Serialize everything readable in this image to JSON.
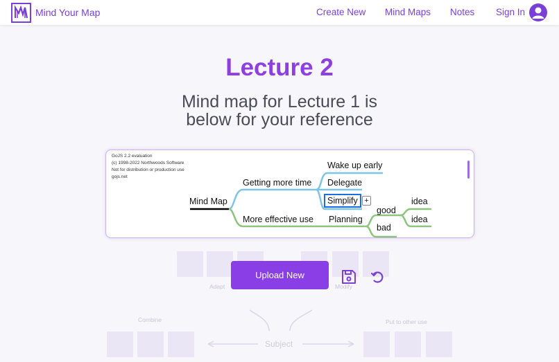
{
  "header": {
    "brand": "Mind Your Map",
    "nav": [
      "Create New",
      "Mind Maps",
      "Notes",
      "Sign In"
    ]
  },
  "page": {
    "title": "Lecture 2",
    "subtitle_line1": "Mind map for Lecture 1 is",
    "subtitle_line2": "below for your reference"
  },
  "mindmap": {
    "watermark": [
      "GoJS 2.2 evaluation",
      "(c) 1998-2022 Northwoods Software",
      "Not for distribution or production use",
      "gojs.net"
    ],
    "root": "Mind Map",
    "nodes": {
      "getting_more_time": "Getting more time",
      "wake_up_early": "Wake up early",
      "delegate": "Delegate",
      "simplify": "Simplify",
      "more_effective_use": "More effective use",
      "planning": "Planning",
      "good": "good",
      "bad": "bad",
      "idea_top": "idea",
      "idea_bottom": "idea"
    },
    "plus_label": "+",
    "branch_colors": {
      "top": "#7fc4e4",
      "bottom": "#8cc47d",
      "root": "#000000"
    }
  },
  "actions": {
    "upload_label": "Upload New",
    "save_icon": "save-icon",
    "refresh_icon": "refresh-icon"
  },
  "background_diagram": {
    "labels": [
      "Adapt",
      "Modify",
      "Combine",
      "Put to other use"
    ],
    "subject": "Subject"
  },
  "colors": {
    "accent": "#8a3ee5",
    "brand": "#7a3fd6"
  }
}
